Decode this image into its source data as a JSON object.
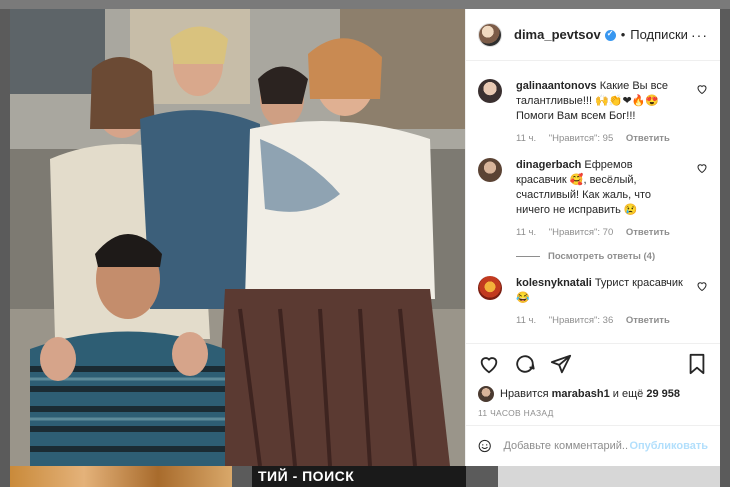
{
  "background": {
    "banner_text": "ТИЙ - ПОИСК"
  },
  "post": {
    "author": "dima_pevtsov",
    "verified_icon": "verified-badge-icon",
    "follow_separator": "•",
    "follow_label": "Подписки",
    "more_icon": "ellipsis-icon",
    "more_glyph": "···"
  },
  "comments": [
    {
      "user": "galinaantonovs",
      "text": "Какие Вы все талантливые!!! 🙌👏❤🔥😍 Помоги Вам всем Бог!!!",
      "time": "11 ч.",
      "likes": "\"Нравится\": 95",
      "reply": "Ответить"
    },
    {
      "user": "dinagerbach",
      "text": "Ефремов красавчик 🥰, весёлый, счастливый! Как жаль, что ничего не исправить 😢",
      "time": "11 ч.",
      "likes": "\"Нравится\": 70",
      "reply": "Ответить"
    },
    {
      "user": "kolesnyknatali",
      "text": "Турист красавчик 😂",
      "time": "11 ч.",
      "likes": "\"Нравится\": 36",
      "reply": "Ответить"
    }
  ],
  "view_replies": "Посмотреть ответы (4)",
  "actions": {
    "like_icon": "heart-icon",
    "comment_icon": "comment-icon",
    "share_icon": "share-icon",
    "save_icon": "bookmark-icon"
  },
  "likes": {
    "prefix": "Нравится",
    "user": "marabash1",
    "middle": "и ещё",
    "count": "29 958"
  },
  "timestamp": "11 ЧАСОВ НАЗАД",
  "add_comment": {
    "placeholder": "Добавьте комментарий...",
    "publish_label": "Опубликовать",
    "emoji_icon": "smiley-icon"
  }
}
